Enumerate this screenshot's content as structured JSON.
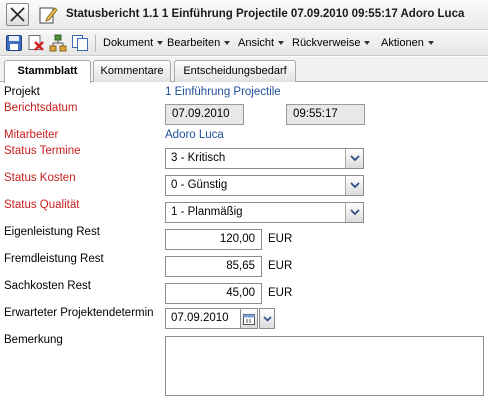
{
  "window": {
    "title": "Statusbericht 1.1 1 Einführung Projectile 07.09.2010 09:55:17 Adoro Luca"
  },
  "toolbar": {
    "icons": [
      "save-icon",
      "delete-icon",
      "tree-icon",
      "copy-icon"
    ],
    "menus": [
      "Dokument",
      "Bearbeiten",
      "Ansicht",
      "Rückverweise",
      "Aktionen"
    ]
  },
  "tabs": [
    "Stammblatt",
    "Kommentare",
    "Entscheidungsbedarf"
  ],
  "form": {
    "projekt": {
      "label": "Projekt",
      "value": "1 Einführung Projectile"
    },
    "berichtsdatum": {
      "label": "Berichtsdatum",
      "date": "07.09.2010",
      "time": "09:55:17"
    },
    "mitarbeiter": {
      "label": "Mitarbeiter",
      "value": "Adoro Luca"
    },
    "status_termine": {
      "label": "Status Termine",
      "value": "3 - Kritisch"
    },
    "status_kosten": {
      "label": "Status Kosten",
      "value": "0 - Günstig"
    },
    "status_qualitaet": {
      "label": "Status Qualität",
      "value": "1 - Planmäßig"
    },
    "eigenleistung_rest": {
      "label": "Eigenleistung Rest",
      "value": "120,00",
      "unit": "EUR"
    },
    "fremdleistung_rest": {
      "label": "Fremdleistung Rest",
      "value": "85,65",
      "unit": "EUR"
    },
    "sachkosten_rest": {
      "label": "Sachkosten Rest",
      "value": "45,00",
      "unit": "EUR"
    },
    "erwarteter_termin": {
      "label": "Erwarteter Projektendetermin",
      "value": "07.09.2010"
    },
    "bemerkung": {
      "label": "Bemerkung",
      "value": ""
    }
  },
  "colors": {
    "required_label": "#c8201f",
    "link": "#1f4f9a",
    "readonly_bg": "#e8e8e8"
  }
}
